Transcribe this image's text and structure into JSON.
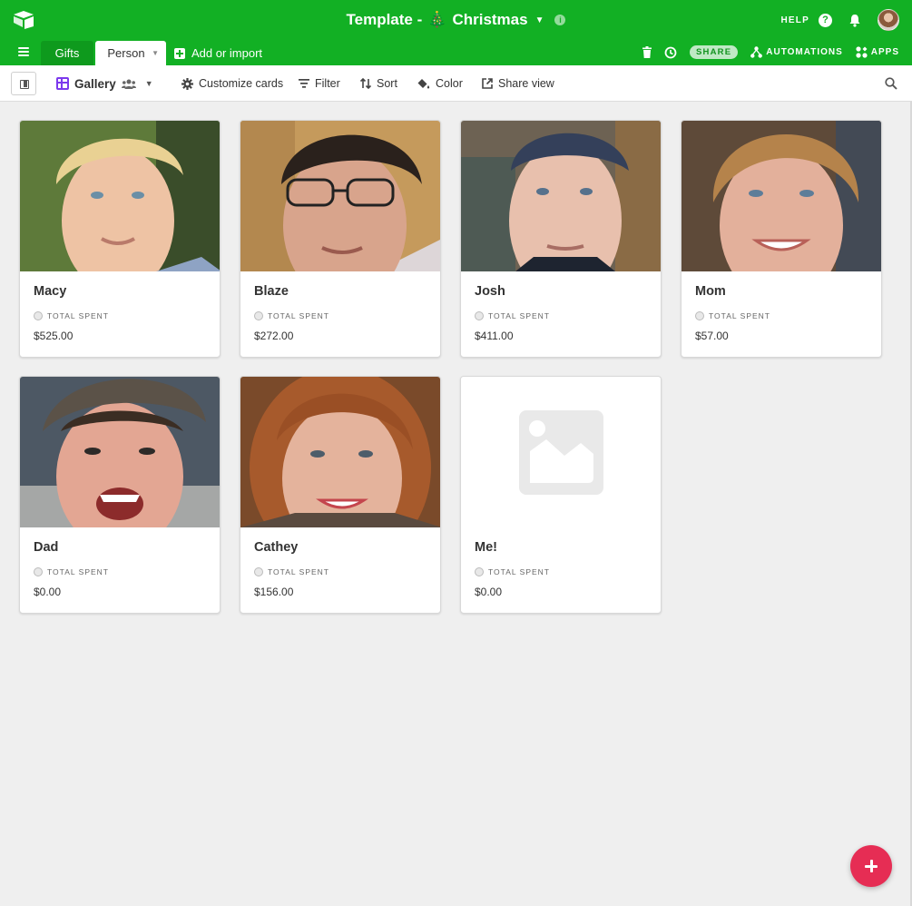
{
  "header": {
    "title": "Template - ",
    "title_emoji": "🎄",
    "title_suffix": "Christmas",
    "help_label": "HELP",
    "brand_color": "#12b024"
  },
  "tabs": [
    {
      "label": "Gifts"
    },
    {
      "label": "Person"
    }
  ],
  "add_import_label": "Add or import",
  "tab_actions": {
    "share_label": "SHARE",
    "automations_label": "AUTOMATIONS",
    "apps_label": "APPS"
  },
  "toolbar": {
    "view_label": "Gallery",
    "customize_label": "Customize cards",
    "filter_label": "Filter",
    "sort_label": "Sort",
    "color_label": "Color",
    "share_view_label": "Share view"
  },
  "cards": [
    {
      "name": "Macy",
      "field_label": "TOTAL SPENT",
      "value": "$525.00"
    },
    {
      "name": "Blaze",
      "field_label": "TOTAL SPENT",
      "value": "$272.00"
    },
    {
      "name": "Josh",
      "field_label": "TOTAL SPENT",
      "value": "$411.00"
    },
    {
      "name": "Mom",
      "field_label": "TOTAL SPENT",
      "value": "$57.00"
    },
    {
      "name": "Dad",
      "field_label": "TOTAL SPENT",
      "value": "$0.00"
    },
    {
      "name": "Cathey",
      "field_label": "TOTAL SPENT",
      "value": "$156.00"
    },
    {
      "name": "Me!",
      "field_label": "TOTAL SPENT",
      "value": "$0.00"
    }
  ],
  "fab_color": "#e62d54"
}
